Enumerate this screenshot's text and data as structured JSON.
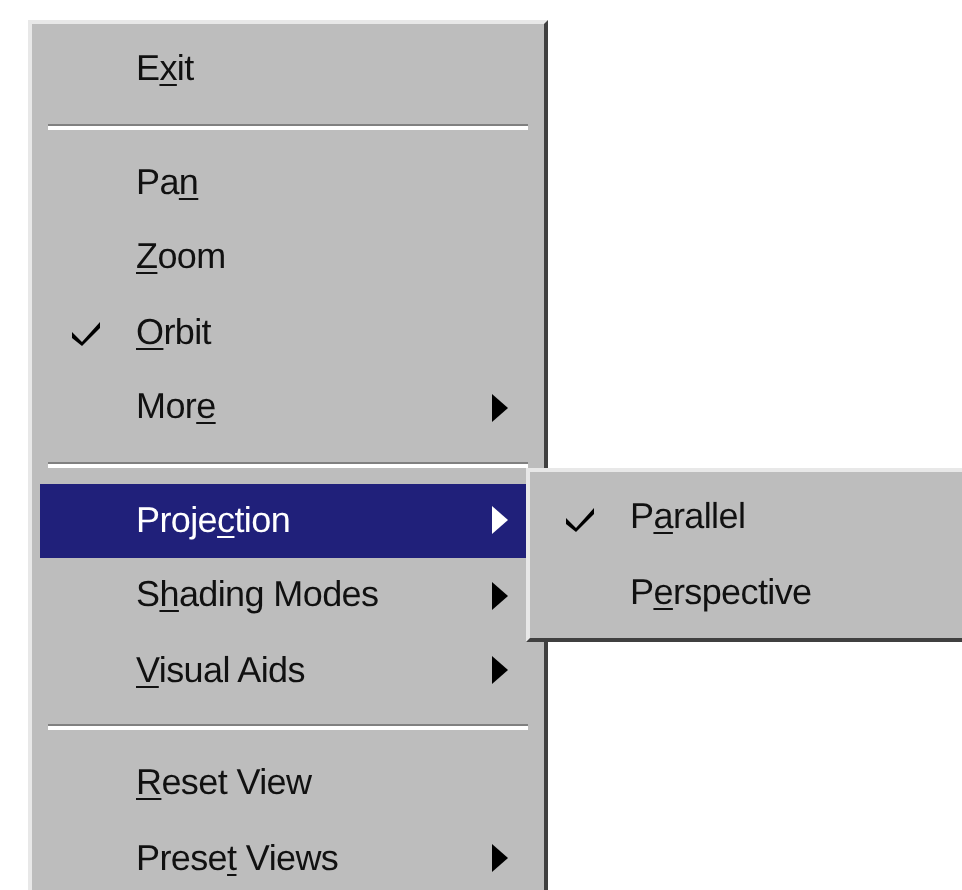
{
  "menu": {
    "items": [
      {
        "kind": "item",
        "label_parts": [
          {
            "text": "E",
            "underlined": false
          },
          {
            "text": "x",
            "underlined": true
          },
          {
            "text": "it",
            "underlined": false
          }
        ],
        "checked": false,
        "has_submenu": false,
        "selected": false
      },
      {
        "kind": "separator"
      },
      {
        "kind": "item",
        "label_parts": [
          {
            "text": "Pa",
            "underlined": false
          },
          {
            "text": "n",
            "underlined": true
          }
        ],
        "checked": false,
        "has_submenu": false,
        "selected": false
      },
      {
        "kind": "item",
        "label_parts": [
          {
            "text": "Z",
            "underlined": true
          },
          {
            "text": "oom",
            "underlined": false
          }
        ],
        "checked": false,
        "has_submenu": false,
        "selected": false
      },
      {
        "kind": "item",
        "label_parts": [
          {
            "text": "O",
            "underlined": true
          },
          {
            "text": "rbit",
            "underlined": false
          }
        ],
        "checked": true,
        "has_submenu": false,
        "selected": false
      },
      {
        "kind": "item",
        "label_parts": [
          {
            "text": "Mor",
            "underlined": false
          },
          {
            "text": "e",
            "underlined": true
          }
        ],
        "checked": false,
        "has_submenu": true,
        "selected": false
      },
      {
        "kind": "separator"
      },
      {
        "kind": "item",
        "label_parts": [
          {
            "text": "Proje",
            "underlined": false
          },
          {
            "text": "c",
            "underlined": true
          },
          {
            "text": "tion",
            "underlined": false
          }
        ],
        "checked": false,
        "has_submenu": true,
        "selected": true
      },
      {
        "kind": "item",
        "label_parts": [
          {
            "text": "S",
            "underlined": false
          },
          {
            "text": "h",
            "underlined": true
          },
          {
            "text": "ading Modes",
            "underlined": false
          }
        ],
        "checked": false,
        "has_submenu": true,
        "selected": false
      },
      {
        "kind": "item",
        "label_parts": [
          {
            "text": "V",
            "underlined": true
          },
          {
            "text": "isual Aids",
            "underlined": false
          }
        ],
        "checked": false,
        "has_submenu": true,
        "selected": false
      },
      {
        "kind": "separator"
      },
      {
        "kind": "item",
        "label_parts": [
          {
            "text": "R",
            "underlined": true
          },
          {
            "text": "eset View",
            "underlined": false
          }
        ],
        "checked": false,
        "has_submenu": false,
        "selected": false
      },
      {
        "kind": "item",
        "label_parts": [
          {
            "text": "Prese",
            "underlined": false
          },
          {
            "text": "t",
            "underlined": true
          },
          {
            "text": " Views",
            "underlined": false
          }
        ],
        "checked": false,
        "has_submenu": true,
        "selected": false
      }
    ]
  },
  "submenu": {
    "items": [
      {
        "kind": "item",
        "label_parts": [
          {
            "text": "P",
            "underlined": false
          },
          {
            "text": "a",
            "underlined": true
          },
          {
            "text": "rallel",
            "underlined": false
          }
        ],
        "checked": true,
        "has_submenu": false,
        "selected": false
      },
      {
        "kind": "item",
        "label_parts": [
          {
            "text": "P",
            "underlined": false
          },
          {
            "text": "e",
            "underlined": true
          },
          {
            "text": "rspective",
            "underlined": false
          }
        ],
        "checked": false,
        "has_submenu": false,
        "selected": false
      }
    ]
  }
}
